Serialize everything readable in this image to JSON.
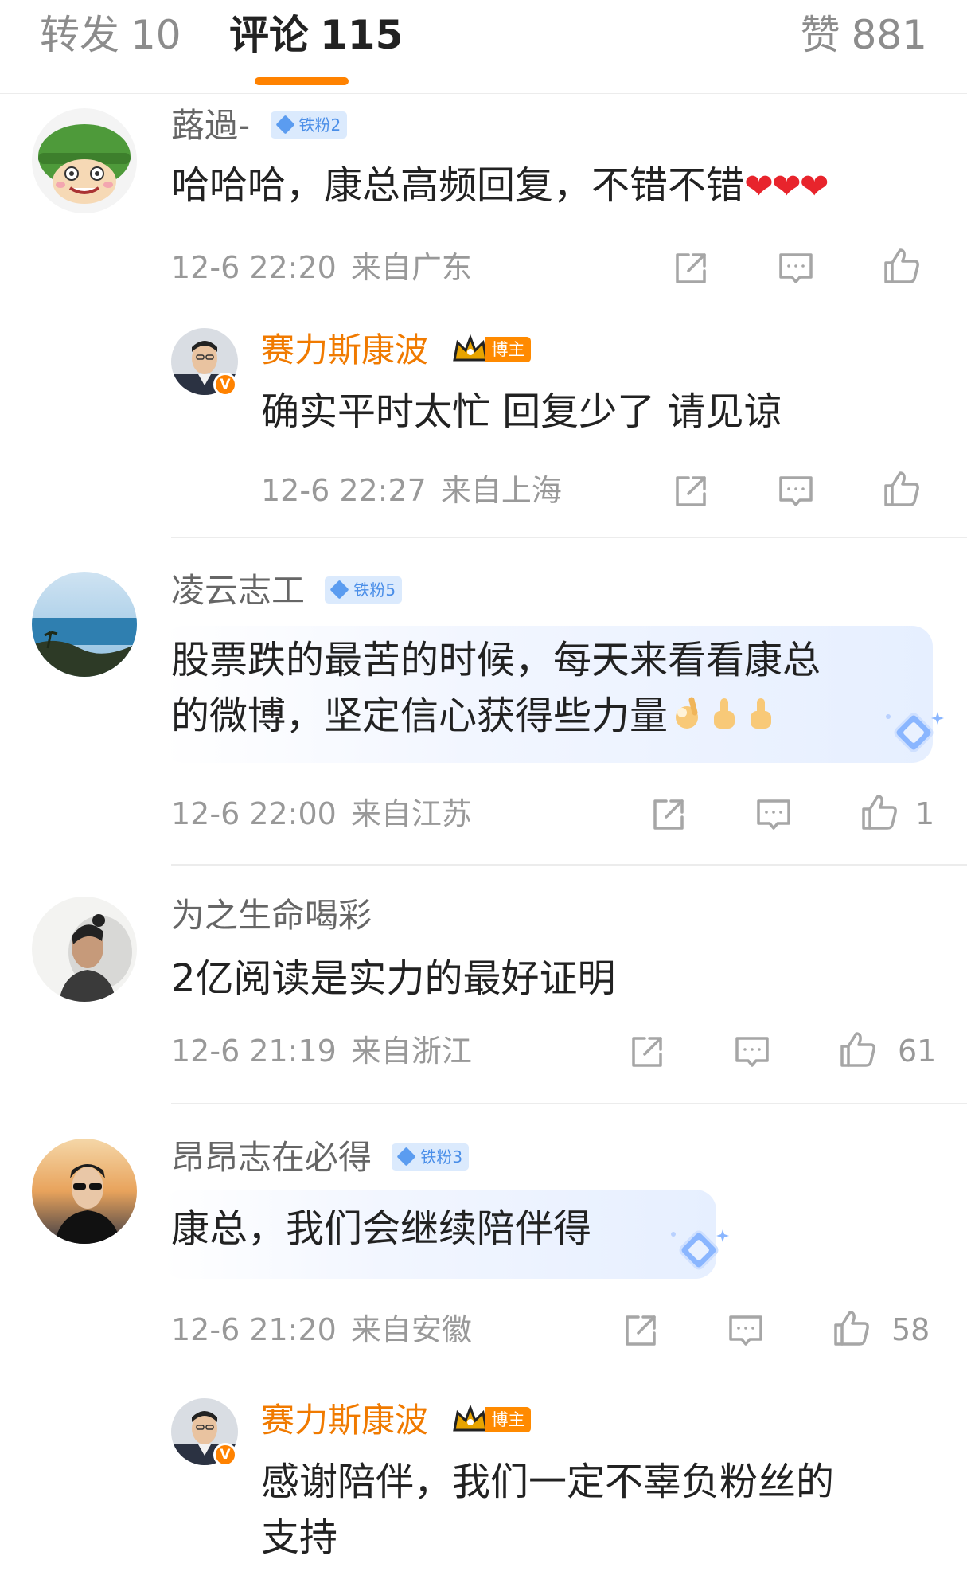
{
  "tabs": {
    "repost": {
      "label": "转发",
      "count": "10"
    },
    "comment": {
      "label": "评论",
      "count": "115"
    },
    "like": {
      "label": "赞",
      "count": "881"
    }
  },
  "comments": [
    {
      "user": "蕗過-",
      "badge": "铁粉2",
      "text": "哈哈哈，康总高频回复，不错不错",
      "emoji": "❤❤❤",
      "time": "12-6 22:20",
      "location": "来自广东",
      "likes": "",
      "reply": {
        "user": "赛力斯康波",
        "badge": "博主",
        "text": "确实平时太忙 回复少了 请见谅",
        "time": "12-6 22:27",
        "location": "来自上海",
        "likes": ""
      }
    },
    {
      "user": "凌云志工",
      "badge": "铁粉5",
      "text_line1": "股票跌的最苦的时候，每天来看看康总",
      "text_line2": "的微博，坚定信心获得些力量",
      "time": "12-6 22:00",
      "location": "来自江苏",
      "likes": "1"
    },
    {
      "user": "为之生命喝彩",
      "text": "2亿阅读是实力的最好证明",
      "time": "12-6 21:19",
      "location": "来自浙江",
      "likes": "61"
    },
    {
      "user": "昂昂志在必得",
      "badge": "铁粉3",
      "text": "康总，我们会继续陪伴得",
      "time": "12-6 21:20",
      "location": "来自安徽",
      "likes": "58",
      "reply": {
        "user": "赛力斯康波",
        "badge": "博主",
        "text_line1": "感谢陪伴，我们一定不辜负粉丝的",
        "text_line2": "支持"
      }
    }
  ],
  "icons": {
    "share": "share-icon",
    "comment": "comment-icon",
    "like": "thumbs-up-icon",
    "verified": "verified-v-icon"
  },
  "colors": {
    "accent": "#ff8200",
    "owner_name": "#f07a00",
    "fan_badge": "#4a8ee8",
    "heart": "#e8242c",
    "muted_text": "#999999"
  },
  "verified_mark": "V"
}
